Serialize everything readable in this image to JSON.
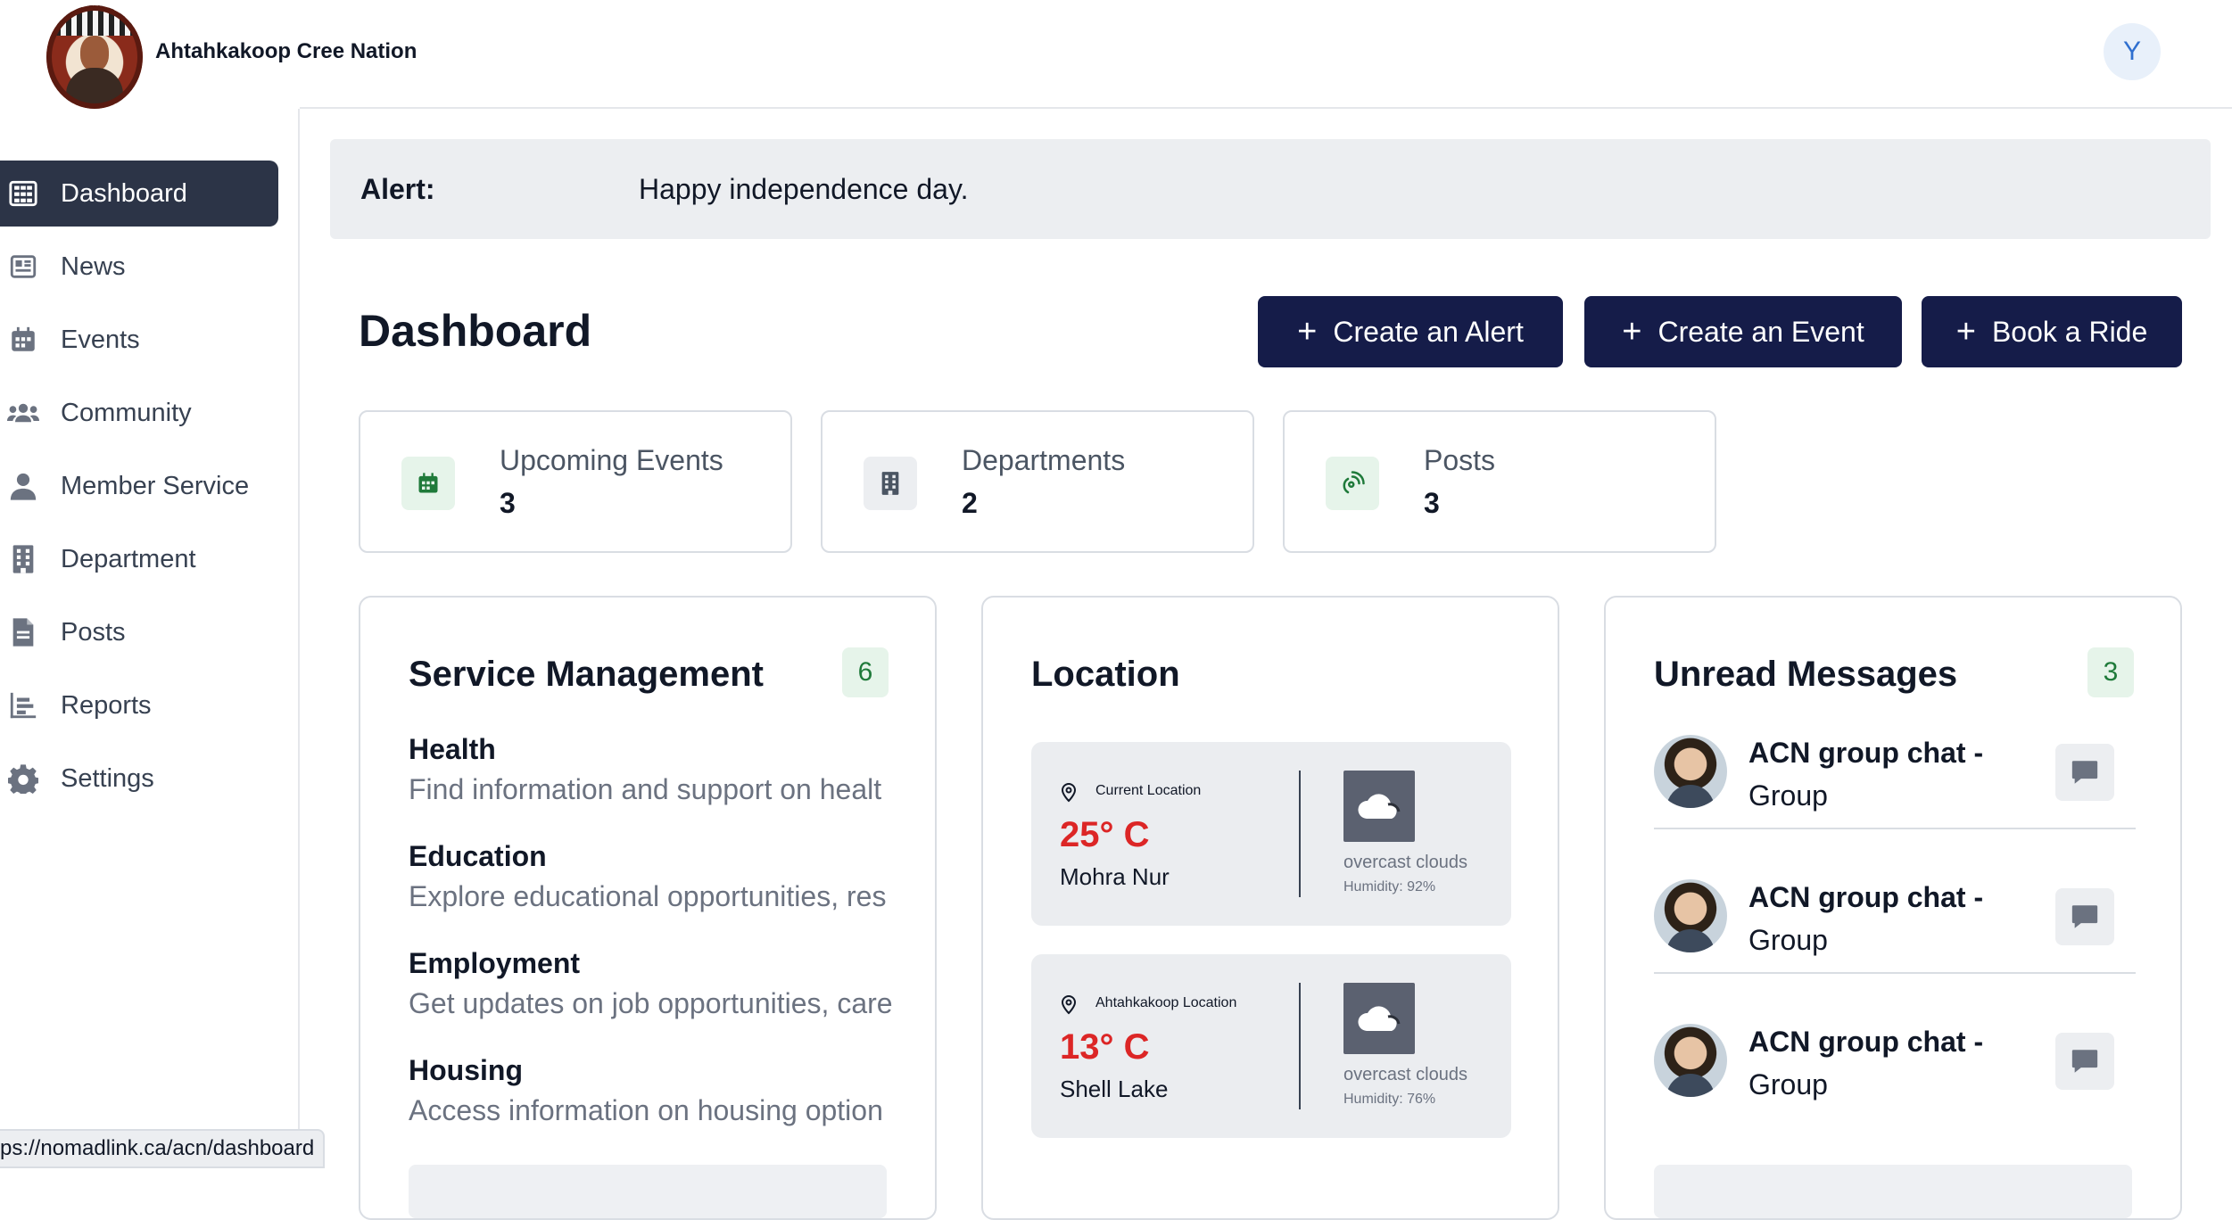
{
  "header": {
    "brand": "Ahtahkakoop Cree Nation",
    "avatar_initial": "Y"
  },
  "sidebar": {
    "items": [
      {
        "label": "Dashboard",
        "icon": "grid-icon",
        "active": true
      },
      {
        "label": "News",
        "icon": "newspaper-icon"
      },
      {
        "label": "Events",
        "icon": "calendar-icon"
      },
      {
        "label": "Community",
        "icon": "users-icon"
      },
      {
        "label": "Member Service",
        "icon": "user-icon"
      },
      {
        "label": "Department",
        "icon": "building-icon"
      },
      {
        "label": "Posts",
        "icon": "document-icon"
      },
      {
        "label": "Reports",
        "icon": "bar-chart-icon"
      },
      {
        "label": "Settings",
        "icon": "gear-icon"
      }
    ]
  },
  "alert": {
    "label": "Alert:",
    "message": "Happy independence day."
  },
  "page": {
    "title": "Dashboard"
  },
  "actions": {
    "create_alert": "Create an Alert",
    "create_event": "Create an Event",
    "book_ride": "Book a Ride"
  },
  "stats": [
    {
      "label": "Upcoming Events",
      "value": "3",
      "icon": "calendar-icon"
    },
    {
      "label": "Departments",
      "value": "2",
      "icon": "building-icon"
    },
    {
      "label": "Posts",
      "value": "3",
      "icon": "broadcast-icon"
    }
  ],
  "services": {
    "title": "Service Management",
    "count": "6",
    "items": [
      {
        "title": "Health",
        "desc": "Find information and support on healt"
      },
      {
        "title": "Education",
        "desc": "Explore educational opportunities, res"
      },
      {
        "title": "Employment",
        "desc": "Get updates on job opportunities, care"
      },
      {
        "title": "Housing",
        "desc": "Access information on housing option"
      }
    ]
  },
  "location": {
    "title": "Location",
    "cards": [
      {
        "caption": "Current Location",
        "temp": "25° C",
        "city": "Mohra Nur",
        "condition": "overcast clouds",
        "humidity": "Humidity: 92%"
      },
      {
        "caption": "Ahtahkakoop Location",
        "temp": "13° C",
        "city": "Shell Lake",
        "condition": "overcast clouds",
        "humidity": "Humidity: 76%"
      }
    ]
  },
  "messages": {
    "title": "Unread Messages",
    "count": "3",
    "items": [
      {
        "name": "ACN group chat -",
        "type": "Group"
      },
      {
        "name": "ACN group chat -",
        "type": "Group"
      },
      {
        "name": "ACN group chat -",
        "type": "Group"
      }
    ]
  },
  "status_url": "ps://nomadlink.ca/acn/dashboard"
}
